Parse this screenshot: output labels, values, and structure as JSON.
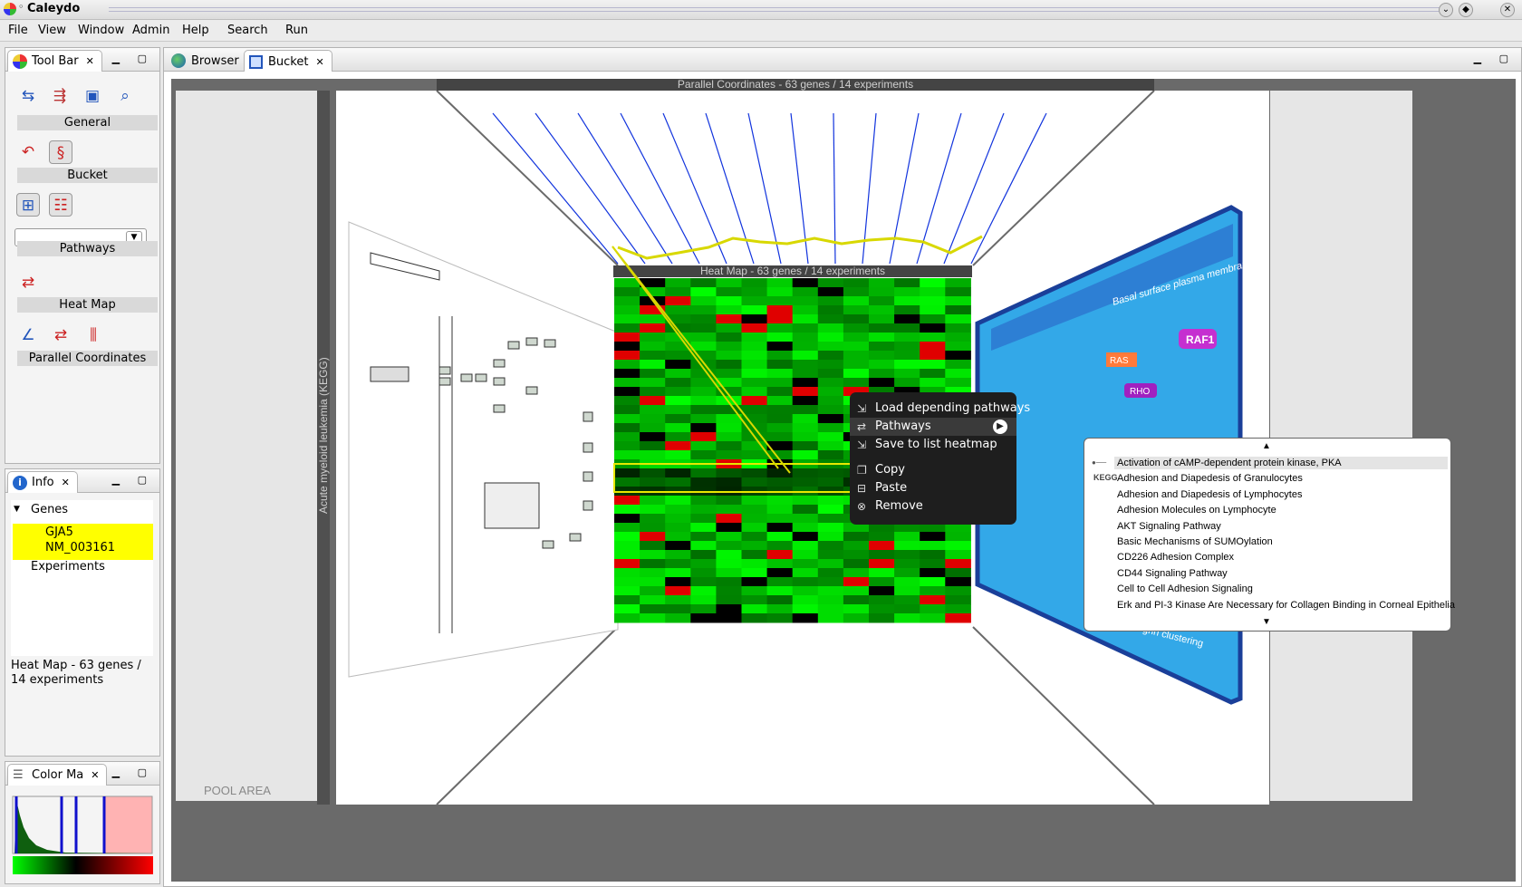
{
  "app": {
    "title": "Caleydo"
  },
  "menu": [
    "File",
    "View",
    "Window",
    "Admin",
    "Help",
    "Search",
    "Run"
  ],
  "toolbar": {
    "tab_label": "Tool Bar",
    "groups": [
      "General",
      "Bucket",
      "Pathways",
      "Heat Map",
      "Parallel Coordinates"
    ],
    "pathway_select_value": ""
  },
  "info": {
    "tab_label": "Info",
    "genes_label": "Genes",
    "gene_name": "GJA5",
    "gene_id": "NM_003161",
    "experiments_label": "Experiments",
    "status": "Heat Map - 63 genes / 14 experiments"
  },
  "colormap": {
    "tab_label": "Color Ma"
  },
  "editor": {
    "tabs": [
      "Browser",
      "Bucket"
    ]
  },
  "scene": {
    "parcoords_title": "Parallel Coordinates - 63 genes / 14 experiments",
    "heatmap_title": "Heat Map - 63 genes / 14 experiments",
    "left_wall_label": "Acute myeloid leukemia (KEGG)",
    "pool_area": "POOL AREA",
    "pathway_labels": [
      "Basal surface plasma membrane",
      "RAF1",
      "RAS",
      "RHO",
      "Integrin clustering"
    ]
  },
  "context_menu": [
    "Load depending pathways",
    "Pathways",
    "Save to list heatmap",
    "Copy",
    "Paste",
    "Remove"
  ],
  "pathways_submenu": [
    "Activation of cAMP-dependent protein kinase, PKA",
    "Adhesion and Diapedesis of Granulocytes",
    "Adhesion and Diapedesis of Lymphocytes",
    "Adhesion Molecules on Lymphocyte",
    "AKT Signaling Pathway",
    "Basic Mechanisms of SUMOylation",
    "CD226 Adhesion Complex",
    "CD44 Signaling Pathway",
    "Cell to Cell Adhesion Signaling",
    "Erk and PI-3 Kinase Are Necessary for Collagen Binding in Corneal Epithelia"
  ],
  "colors": {
    "accent_blue": "#1144cc",
    "highlight_yellow": "#ffff00",
    "heat_green": "#00ff00",
    "heat_red": "#e00000",
    "pathway_bg": "#33a8e8"
  }
}
